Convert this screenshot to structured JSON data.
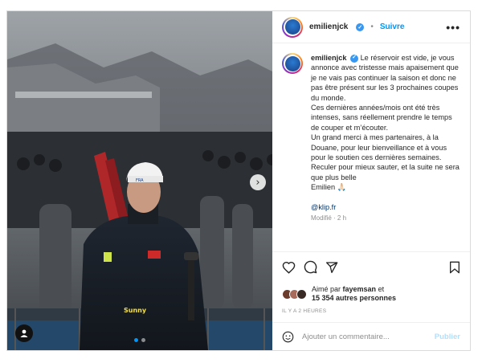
{
  "header": {
    "username": "emilienjck",
    "follow_label": "Suivre",
    "bullet": "•",
    "more": "•••"
  },
  "photo": {
    "next_arrow": "›",
    "slide_count": 2,
    "active_slide": 1
  },
  "caption": {
    "username": "emilienjck",
    "lines": [
      "Le réservoir est vide, je vous annonce avec tristesse mais apaisement que je ne vais pas continuer la saison et donc ne pas être présent sur les 3 prochaines coupes du monde.",
      "Ces dernières années/mois ont été très intenses, sans réellement prendre le temps de couper et m’écouter.",
      "Un grand merci à mes partenaires, à la Douane, pour leur bienveillance et à vous pour le soutien ces dernières semaines.",
      "Reculer pour mieux sauter, et la suite ne sera que plus belle",
      "Emilien 🙏🏻"
    ],
    "link": "@klip.fr",
    "time_partial": "Modifié · 2 h"
  },
  "likes": {
    "prefix": "Aimé par",
    "first_liker": "fayemsan",
    "conjunction": "et",
    "others": "15 354 autres personnes"
  },
  "timestamp": "IL Y A 2 HEURES",
  "comment_box": {
    "placeholder": "Ajouter un commentaire...",
    "publish_label": "Publier"
  },
  "colors": {
    "accent": "#0095f6",
    "verified": "#3897f0",
    "publish_disabled": "#b2dffc"
  }
}
